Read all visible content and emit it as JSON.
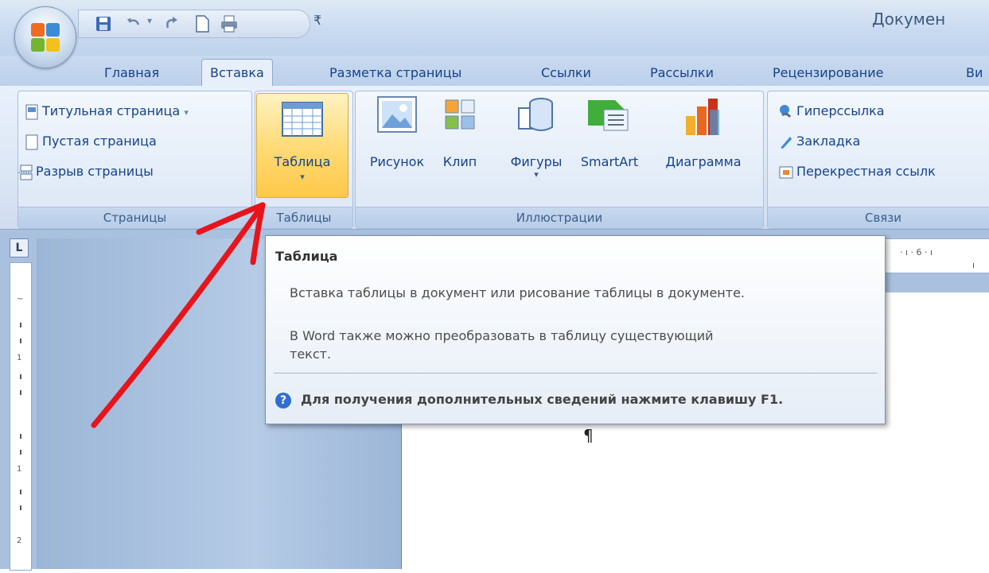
{
  "window": {
    "doc_title": "Докумен"
  },
  "tabs": [
    {
      "label": "Главная"
    },
    {
      "label": "Вставка"
    },
    {
      "label": "Разметка страницы"
    },
    {
      "label": "Ссылки"
    },
    {
      "label": "Рассылки"
    },
    {
      "label": "Рецензирование"
    },
    {
      "label": "Ви"
    }
  ],
  "groups": {
    "pages": {
      "label": "Страницы",
      "items": [
        "Титульная страница",
        "Пустая страница",
        "Разрыв страницы"
      ]
    },
    "tables": {
      "label": "Таблицы",
      "button": "Таблица"
    },
    "illustrations": {
      "label": "Иллюстрации",
      "items": [
        "Рисунок",
        "Клип",
        "Фигуры",
        "SmartArt",
        "Диаграмма"
      ]
    },
    "links": {
      "label": "Связи",
      "items": [
        "Гиперссылка",
        "Закладка",
        "Перекрестная ссылк"
      ]
    }
  },
  "ruler": {
    "corner": "L"
  },
  "document": {
    "pilcrow": "¶"
  },
  "tooltip": {
    "title": "Таблица",
    "line1": "Вставка таблицы в документ или рисование таблицы в документе.",
    "line2": "В Word также можно преобразовать в таблицу существующий",
    "line3": "текст.",
    "help": "Для получения дополнительных сведений нажмите клавишу F1."
  },
  "colors": {
    "annotation_arrow": "#e8141b",
    "highlight": "#ffd972"
  }
}
